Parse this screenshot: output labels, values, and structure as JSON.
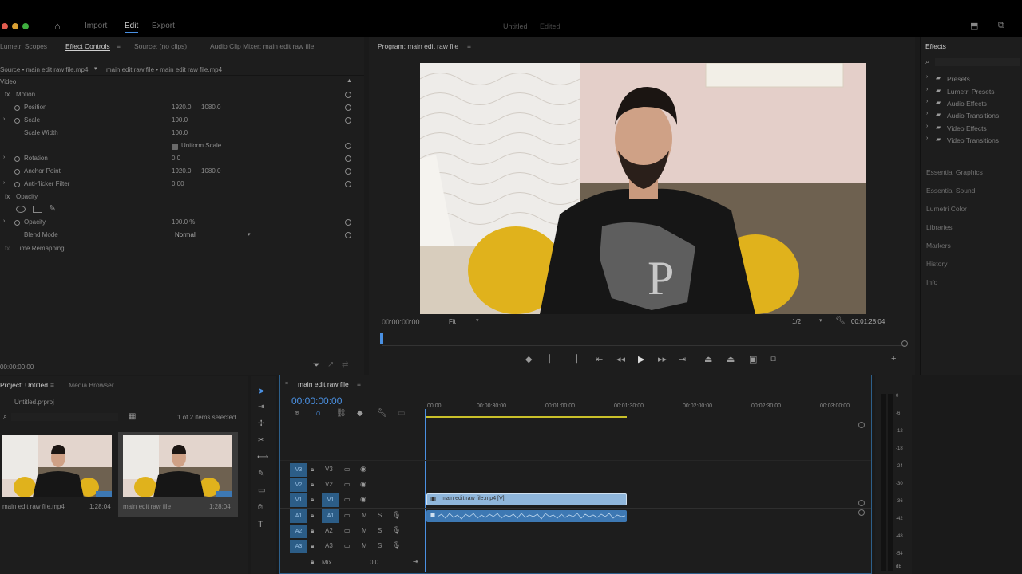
{
  "app": {
    "tabs": [
      "Import",
      "Edit",
      "Export"
    ],
    "title": "Untitled",
    "title_status": "Edited"
  },
  "effect_controls": {
    "tabs": [
      "Lumetri Scopes",
      "Effect Controls",
      "Source: (no clips)",
      "Audio Clip Mixer: main edit raw file"
    ],
    "source_path": "Source • main edit raw file.mp4",
    "seq_path": "main edit raw file • main edit raw file.mp4",
    "section": "Video",
    "motion": "Motion",
    "position_label": "Position",
    "position_x": "1920.0",
    "position_y": "1080.0",
    "scale_label": "Scale",
    "scale_value": "100.0",
    "scale_width_label": "Scale Width",
    "scale_width_value": "100.0",
    "uniform_scale": "Uniform Scale",
    "rotation_label": "Rotation",
    "rotation_value": "0.0",
    "anchor_label": "Anchor Point",
    "anchor_x": "1920.0",
    "anchor_y": "1080.0",
    "antiflicker_label": "Anti-flicker Filter",
    "antiflicker_value": "0.00",
    "opacity_section": "Opacity",
    "opacity_label": "Opacity",
    "opacity_value": "100.0 %",
    "blend_label": "Blend Mode",
    "blend_value": "Normal",
    "time_remap": "Time Remapping",
    "timecode": "00:00:00:00"
  },
  "program": {
    "title": "Program: main edit raw file",
    "timecode": "00:00:00:00",
    "fit": "Fit",
    "quality": "1/2",
    "duration": "00:01:28:04"
  },
  "project": {
    "tabs": [
      "Project: Untitled",
      "Media Browser"
    ],
    "file": "Untitled.prproj",
    "selection": "1 of 2 items selected",
    "items": [
      {
        "name": "main edit raw file.mp4",
        "duration": "1:28:04"
      },
      {
        "name": "main edit raw file",
        "duration": "1:28:04"
      }
    ]
  },
  "timeline": {
    "tab": "main edit raw file",
    "timecode": "00:00:00:00",
    "ruler": [
      "00:00",
      "00:00:30:00",
      "00:01:00:00",
      "00:01:30:00",
      "00:02:00:00",
      "00:02:30:00",
      "00:03:00:00"
    ],
    "video_tracks": [
      "V3",
      "V2",
      "V1"
    ],
    "audio_tracks": [
      "A1",
      "A2",
      "A3"
    ],
    "mix_label": "Mix",
    "mix_value": "0.0",
    "video_clip": "main edit raw file.mp4 [V]"
  },
  "effects": {
    "title": "Effects",
    "folders": [
      "Presets",
      "Lumetri Presets",
      "Audio Effects",
      "Audio Transitions",
      "Video Effects",
      "Video Transitions"
    ],
    "panels": [
      "Essential Graphics",
      "Essential Sound",
      "Lumetri Color",
      "Libraries",
      "Markers",
      "History",
      "Info"
    ]
  },
  "audio_meter": {
    "labels": [
      "0",
      "-6",
      "-12",
      "-18",
      "-24",
      "-30",
      "-36",
      "-42",
      "-48",
      "-54",
      "dB"
    ]
  },
  "colors": {
    "accent": "#4a90e2",
    "clip_video": "#8fb6db",
    "clip_audio": "#3d78b3",
    "playhead": "#4a90e2"
  }
}
